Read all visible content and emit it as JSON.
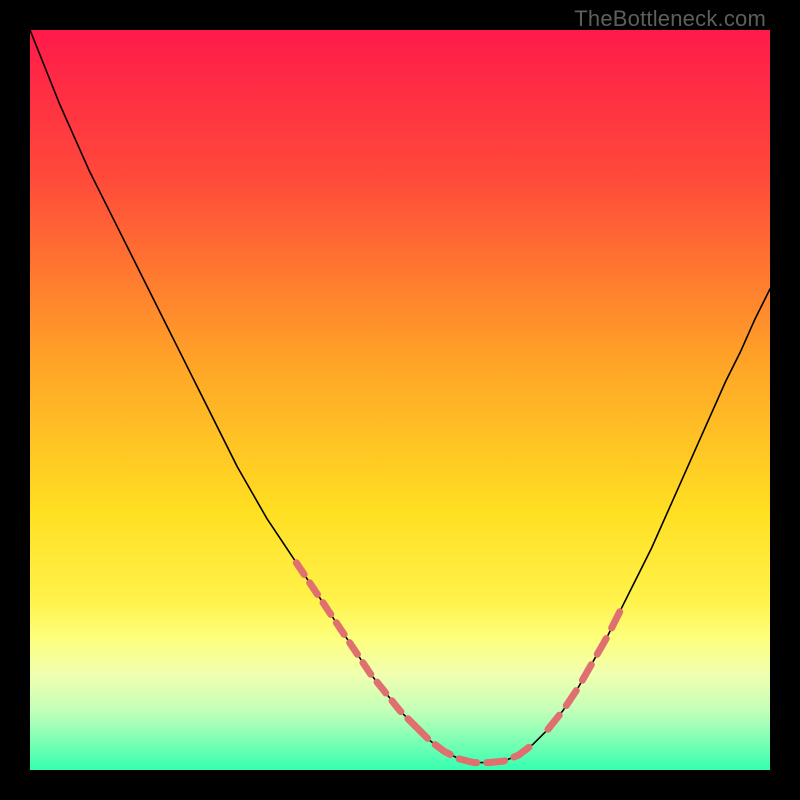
{
  "watermark": "TheBottleneck.com",
  "chart_data": {
    "type": "line",
    "title": "",
    "xlabel": "",
    "ylabel": "",
    "xlim": [
      0,
      100
    ],
    "ylim": [
      0,
      100
    ],
    "grid": false,
    "legend": false,
    "gradient_bg": {
      "direction": "vertical",
      "stops": [
        {
          "offset": 0.0,
          "color": "#ff1a4a"
        },
        {
          "offset": 0.2,
          "color": "#ff4a3a"
        },
        {
          "offset": 0.45,
          "color": "#ffa427"
        },
        {
          "offset": 0.65,
          "color": "#ffdf22"
        },
        {
          "offset": 0.77,
          "color": "#fff24a"
        },
        {
          "offset": 0.82,
          "color": "#fdff7a"
        },
        {
          "offset": 0.87,
          "color": "#f1ffb0"
        },
        {
          "offset": 0.92,
          "color": "#c3ffb8"
        },
        {
          "offset": 0.96,
          "color": "#7dffb4"
        },
        {
          "offset": 1.0,
          "color": "#35ffb0"
        }
      ]
    },
    "series": [
      {
        "name": "curve",
        "color": "#000000",
        "stroke_width": 1.6,
        "x": [
          0,
          2,
          4,
          6,
          8,
          10,
          12,
          14,
          16,
          18,
          20,
          22,
          24,
          26,
          28,
          30,
          32,
          34,
          36,
          38,
          40,
          42,
          44,
          46,
          48,
          50,
          52,
          54,
          56,
          58,
          60,
          62,
          64,
          66,
          68,
          70,
          72,
          74,
          76,
          78,
          80,
          82,
          84,
          86,
          88,
          90,
          92,
          94,
          96,
          98,
          100
        ],
        "y": [
          100,
          95,
          90,
          85.5,
          81,
          77,
          73,
          69,
          65,
          61,
          57,
          53,
          49,
          45,
          41,
          37.5,
          34,
          31,
          28,
          25,
          22,
          19,
          16,
          13,
          10.5,
          8,
          6,
          4,
          2.5,
          1.5,
          1,
          1,
          1.2,
          2,
          3.5,
          5.5,
          8,
          11,
          14.5,
          18,
          22,
          26,
          30,
          34.5,
          39,
          43.5,
          48,
          52.5,
          56.5,
          61,
          65
        ]
      },
      {
        "name": "dashed-left",
        "color": "#e07070",
        "stroke_width": 7,
        "dash": "14 10",
        "x": [
          36,
          38,
          40,
          42,
          44,
          46,
          48,
          50,
          52
        ],
        "y": [
          28,
          25,
          22,
          19,
          16,
          13,
          10.5,
          8,
          6
        ]
      },
      {
        "name": "dashed-bottom",
        "color": "#e07070",
        "stroke_width": 7,
        "dash": "18 10",
        "x": [
          52,
          54,
          56,
          58,
          60,
          62,
          64,
          66,
          68
        ],
        "y": [
          6,
          4,
          2.5,
          1.5,
          1,
          1,
          1.2,
          2,
          3.5
        ]
      },
      {
        "name": "dashed-right",
        "color": "#e07070",
        "stroke_width": 7,
        "dash": "18 12",
        "x": [
          70,
          72,
          74,
          76,
          78,
          80
        ],
        "y": [
          5.5,
          8,
          11,
          14.5,
          18,
          22
        ]
      }
    ]
  }
}
